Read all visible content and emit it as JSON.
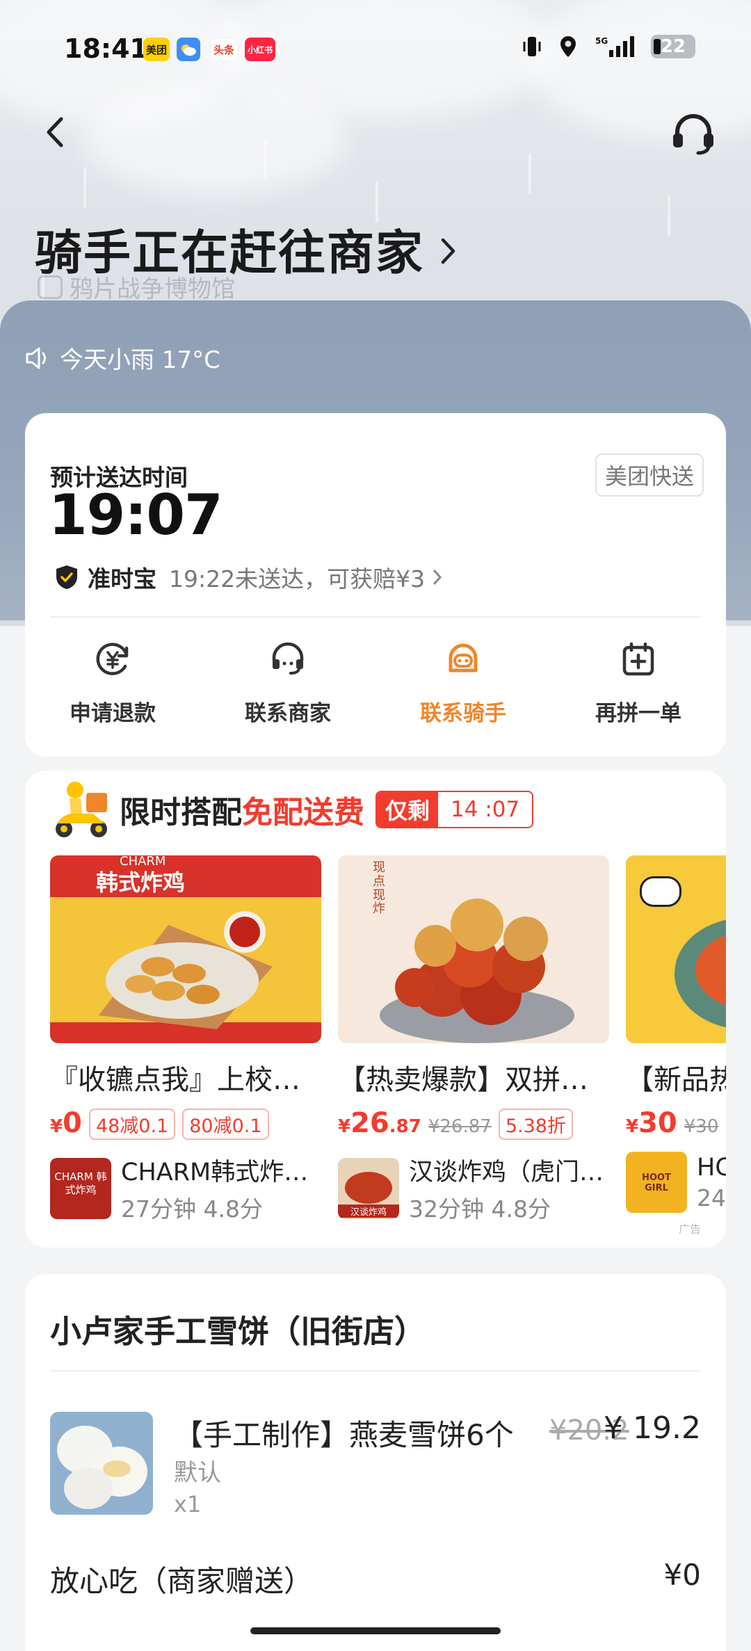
{
  "status_bar": {
    "time": "18:41",
    "apps": [
      {
        "label": "美团",
        "bg": "#ffd100",
        "color": "#222"
      },
      {
        "label": "",
        "bg": "#3e8ef7",
        "color": "#fff"
      },
      {
        "label": "头条",
        "bg": "#ffffff",
        "color": "#f23c2d"
      },
      {
        "label": "小红书",
        "bg": "#ff2442",
        "color": "#fff"
      }
    ],
    "network": "5G",
    "battery": "22"
  },
  "header": {
    "status_title": "骑手正在赶往商家",
    "map_label": "鸦片战争博物馆"
  },
  "weather": {
    "text": "今天小雨 17°C"
  },
  "eta": {
    "label": "预计送达时间",
    "time": "19:07",
    "tag": "美团快送",
    "ontime_name": "准时宝",
    "ontime_desc": "19:22未送达，可获赔¥3"
  },
  "actions": [
    {
      "label": "申请退款",
      "icon": "refund-icon"
    },
    {
      "label": "联系商家",
      "icon": "merchant-icon"
    },
    {
      "label": "联系骑手",
      "icon": "rider-icon",
      "active": true
    },
    {
      "label": "再拼一单",
      "icon": "add-order-icon"
    }
  ],
  "promo": {
    "title": "限时搭配",
    "title_red": "免配送费",
    "timer_label": "仅剩",
    "timer_value": "14 :07",
    "ad_mark": "广告",
    "products": [
      {
        "name": "『收镳点我』上校…",
        "price_yen": "¥",
        "price_int": "0",
        "price_dec": "",
        "old_price": "",
        "chips": [
          "48减0.1",
          "80减0.1"
        ],
        "shop_name": "CHARM韩式炸…",
        "shop_meta": "27分钟 4.8分",
        "image_text": "韩式炸鸡",
        "image_brand": "CHARM",
        "logo_text": "CHARM 韩式炸鸡"
      },
      {
        "name": "【热卖爆款】双拼…",
        "price_yen": "¥",
        "price_int": "26",
        "price_dec": ".87",
        "old_price": "¥26.87",
        "chips": [
          "5.38折"
        ],
        "shop_name": "汉谈炸鸡（虎门…",
        "shop_meta": "32分钟 4.8分",
        "image_text": "现点现炸",
        "logo_text": "汉谈炸鸡"
      },
      {
        "name": "【新品热",
        "price_yen": "¥",
        "price_int": "30",
        "price_dec": "",
        "old_price": "¥30",
        "chips": [],
        "shop_name": "HC",
        "shop_meta": "24",
        "image_text": "",
        "logo_text": "HOOT GIRL"
      }
    ]
  },
  "order": {
    "store": "小卢家手工雪饼（旧街店）",
    "item_name": "【手工制作】燕麦雪饼6个",
    "item_old_price": "¥20.2",
    "item_price": "¥ 19.2",
    "item_spec": "默认",
    "item_qty": "x1",
    "gift_label": "放心吃（商家赠送）",
    "gift_price": "¥0"
  },
  "colors": {
    "accent_orange": "#f0862b",
    "promo_red": "#f23c2d",
    "sheet_blue": "#8fa0b6"
  }
}
